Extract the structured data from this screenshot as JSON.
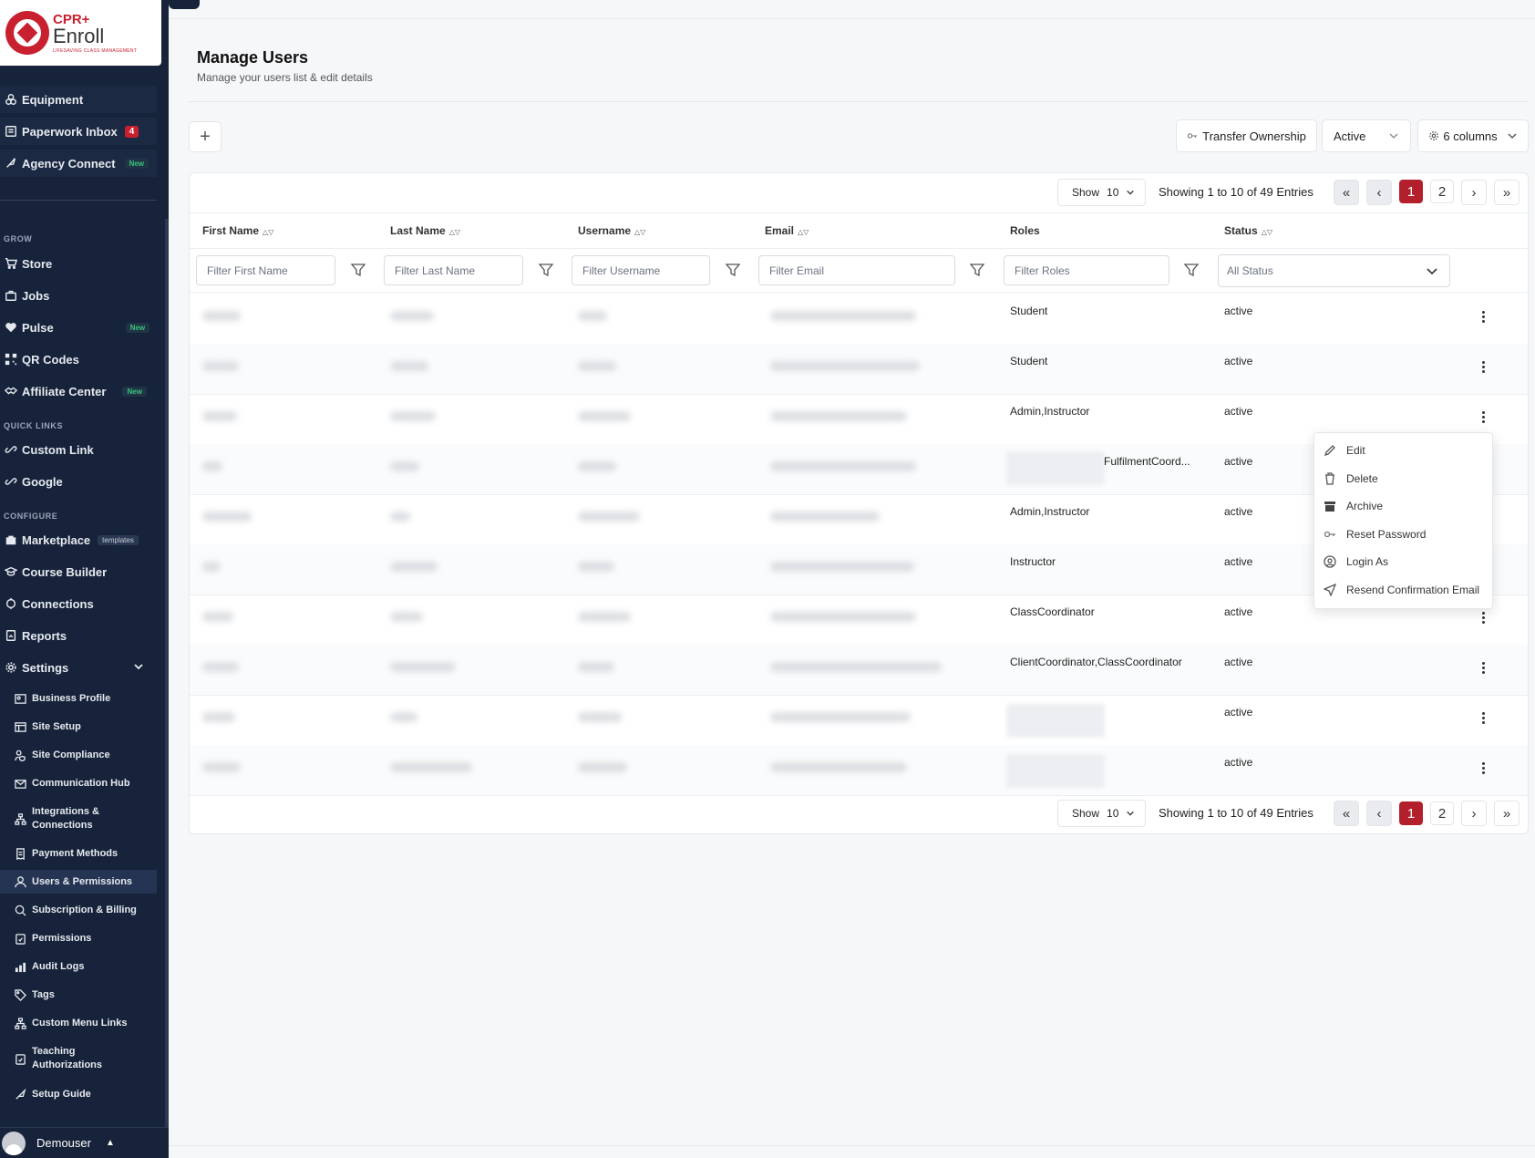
{
  "brand": {
    "line1": "CPR+",
    "line2": "Enroll",
    "tagline": "LIFESAVING CLASS MANAGEMENT"
  },
  "sidebar": {
    "top_items": [
      {
        "label": "Equipment",
        "icon": "equipment-icon"
      },
      {
        "label": "Paperwork Inbox",
        "badge": "4",
        "icon": "inbox-icon"
      },
      {
        "label": "Agency Connect",
        "badge": "New",
        "icon": "rocket-icon"
      }
    ],
    "grow_label": "GROW",
    "grow_items": [
      {
        "label": "Store",
        "icon": "cart-icon"
      },
      {
        "label": "Jobs",
        "icon": "briefcase-icon"
      },
      {
        "label": "Pulse",
        "badge": "New",
        "icon": "heart-pulse-icon"
      },
      {
        "label": "QR Codes",
        "icon": "qr-code-icon"
      },
      {
        "label": "Affiliate Center",
        "badge": "New",
        "icon": "handshake-icon"
      }
    ],
    "quick_label": "QUICK LINKS",
    "quick_items": [
      {
        "label": "Custom Link",
        "icon": "link-icon"
      },
      {
        "label": "Google",
        "icon": "link-icon"
      }
    ],
    "configure_label": "CONFIGURE",
    "configure_items": [
      {
        "label": "Marketplace",
        "badge": "templates",
        "icon": "shop-icon"
      },
      {
        "label": "Course Builder",
        "icon": "graduation-cap-icon"
      },
      {
        "label": "Connections",
        "icon": "plug-icon"
      },
      {
        "label": "Reports",
        "icon": "report-icon"
      },
      {
        "label": "Settings",
        "icon": "gear-icon"
      }
    ],
    "settings_items": [
      {
        "label": "Business Profile"
      },
      {
        "label": "Site Setup"
      },
      {
        "label": "Site Compliance"
      },
      {
        "label": "Communication Hub"
      },
      {
        "label": "Integrations & Connections"
      },
      {
        "label": "Payment Methods"
      },
      {
        "label": "Users & Permissions",
        "active": true
      },
      {
        "label": "Subscription & Billing"
      },
      {
        "label": "Permissions"
      },
      {
        "label": "Audit Logs"
      },
      {
        "label": "Tags"
      },
      {
        "label": "Custom Menu Links"
      },
      {
        "label": "Teaching Authorizations"
      },
      {
        "label": "Setup Guide"
      }
    ],
    "user": {
      "name": "Demouser"
    }
  },
  "page": {
    "title": "Manage Users",
    "subtitle": "Manage your users list & edit details"
  },
  "toolbar": {
    "add_label": "+",
    "transfer_label": "Transfer Ownership",
    "active_value": "Active",
    "columns_label": "6 columns"
  },
  "pagination": {
    "show_label": "Show",
    "page_size": "10",
    "info": "Showing 1 to 10 of 49 Entries",
    "pages": [
      "1",
      "2"
    ],
    "current_page": "1",
    "first": "«",
    "prev": "‹",
    "next": "›",
    "last": "»"
  },
  "table": {
    "columns": [
      "First Name",
      "Last Name",
      "Username",
      "Email",
      "Roles",
      "Status"
    ],
    "filters": {
      "first_name": "Filter First Name",
      "last_name": "Filter Last Name",
      "username": "Filter Username",
      "email": "Filter Email",
      "roles": "Filter Roles",
      "status": "All Status"
    },
    "rows": [
      {
        "roles": "Student",
        "status": "active"
      },
      {
        "roles": "Student",
        "status": "active"
      },
      {
        "roles": "Admin,Instructor",
        "status": "active"
      },
      {
        "roles": "FulfilmentCoord...",
        "status": "active"
      },
      {
        "roles": "Admin,Instructor",
        "status": "active"
      },
      {
        "roles": "Instructor",
        "status": "active"
      },
      {
        "roles": "ClassCoordinator",
        "status": "active"
      },
      {
        "roles": "ClientCoordinator,ClassCoordinator",
        "status": "active"
      },
      {
        "roles": "",
        "status": "active"
      },
      {
        "roles": "",
        "status": "active"
      }
    ]
  },
  "row_menu": {
    "items": [
      {
        "label": "Edit",
        "icon": "pencil-icon"
      },
      {
        "label": "Delete",
        "icon": "trash-icon"
      },
      {
        "label": "Archive",
        "icon": "archive-icon"
      },
      {
        "label": "Reset Password",
        "icon": "key-icon"
      },
      {
        "label": "Login As",
        "icon": "user-circle-icon"
      },
      {
        "label": "Resend Confirmation Email",
        "icon": "send-icon"
      }
    ]
  },
  "colors": {
    "sidebar": "#17233a",
    "accent": "#c8202f",
    "page_current": "#b3202b"
  }
}
